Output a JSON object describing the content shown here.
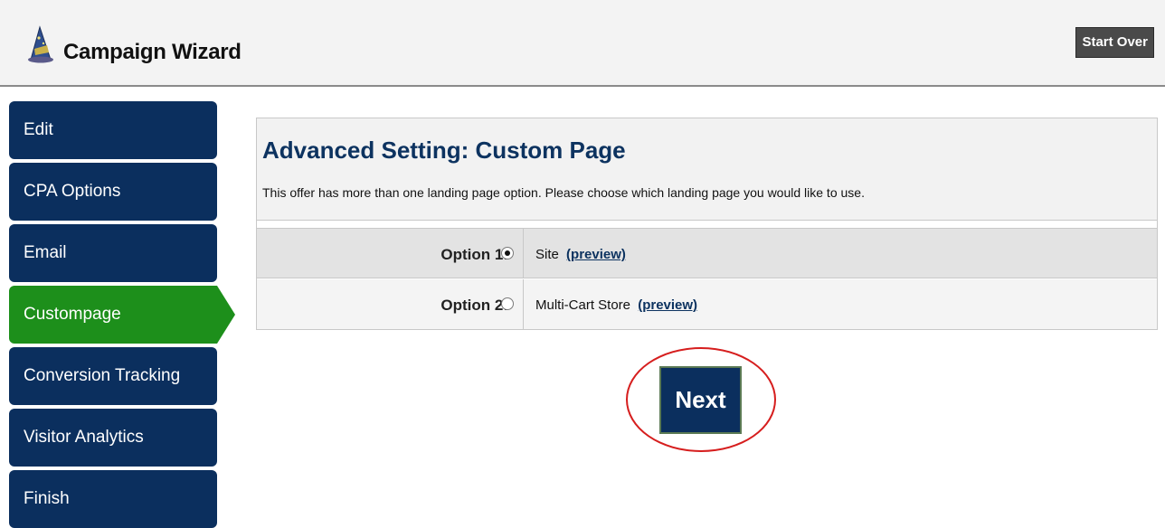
{
  "header": {
    "title": "Campaign Wizard",
    "logo_icon": "wizard-hat-icon",
    "start_over_label": "Start Over"
  },
  "sidebar": {
    "active": "Custompage",
    "items": [
      {
        "label": "Edit"
      },
      {
        "label": "CPA Options"
      },
      {
        "label": "Email"
      },
      {
        "label": "Custompage"
      },
      {
        "label": "Conversion Tracking"
      },
      {
        "label": "Visitor Analytics"
      },
      {
        "label": "Finish"
      }
    ]
  },
  "main": {
    "title": "Advanced Setting: Custom Page",
    "description": "This offer has more than one landing page option. Please choose which landing page you would like to use.",
    "options": [
      {
        "label": "Option 1:",
        "name": "Site",
        "link": "(preview)",
        "selected": true
      },
      {
        "label": "Option 2:",
        "name": "Multi-Cart Store",
        "link": "(preview)",
        "selected": false
      }
    ]
  },
  "next_label": "Next",
  "colors": {
    "nav_blue": "#0b2f5e",
    "active_green": "#1d8f1b",
    "title_blue": "#0d3360",
    "highlight_red": "#d61e1e"
  }
}
